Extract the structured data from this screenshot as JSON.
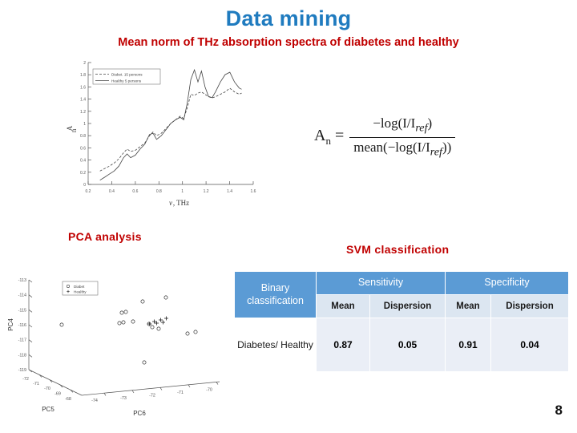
{
  "slide": {
    "title": "Data mining",
    "subtitle": "Mean norm of THz absorption spectra of diabetes and healthy",
    "page_number": "8",
    "title_color": "#1f7bbf",
    "accent_color": "#c00000"
  },
  "labels": {
    "pca": "PCA analysis",
    "svm": "SVM classification"
  },
  "formula": {
    "lhs": "A",
    "lhs_sub": "n",
    "equals": "=",
    "numerator": "−log(I/I",
    "numerator_sub": "ref",
    "numerator_tail": ")",
    "denominator_head": "mean(−log(I/I",
    "denominator_sub": "ref",
    "denominator_tail": "))"
  },
  "chart_data": [
    {
      "type": "line",
      "title": "Mean norm of THz absorption spectra of diabetes and healthy",
      "xlabel": "ν, THz",
      "ylabel": "Aₙ",
      "xlim": [
        0.2,
        1.6
      ],
      "ylim": [
        0,
        2
      ],
      "xticks": [
        "0.2",
        "0.4",
        "0.6",
        "0.8",
        "1",
        "1.2",
        "1.4",
        "1.6"
      ],
      "yticks": [
        "0",
        "0.2",
        "0.4",
        "0.6",
        "0.8",
        "1",
        "1.2",
        "1.4",
        "1.6",
        "1.8",
        "2"
      ],
      "grid": false,
      "legend_position": "upper-left",
      "series": [
        {
          "name": "Diabet. 15 persons",
          "style": "dashed",
          "x": [
            0.3,
            0.34,
            0.38,
            0.42,
            0.46,
            0.5,
            0.53,
            0.56,
            0.6,
            0.64,
            0.68,
            0.72,
            0.75,
            0.78,
            0.82,
            0.86,
            0.9,
            0.94,
            0.98,
            1.01,
            1.04,
            1.07,
            1.1,
            1.13,
            1.16,
            1.19,
            1.22,
            1.25,
            1.28,
            1.32,
            1.36,
            1.4,
            1.44,
            1.48,
            1.5
          ],
          "y": [
            0.22,
            0.26,
            0.3,
            0.35,
            0.42,
            0.52,
            0.58,
            0.54,
            0.56,
            0.62,
            0.68,
            0.8,
            0.86,
            0.8,
            0.84,
            0.92,
            1.0,
            1.06,
            1.12,
            1.08,
            1.26,
            1.48,
            1.46,
            1.5,
            1.52,
            1.48,
            1.44,
            1.42,
            1.44,
            1.48,
            1.52,
            1.58,
            1.52,
            1.48,
            1.5
          ]
        },
        {
          "name": "Healthy 5 persons",
          "style": "solid",
          "x": [
            0.3,
            0.34,
            0.38,
            0.42,
            0.46,
            0.5,
            0.53,
            0.56,
            0.6,
            0.64,
            0.68,
            0.72,
            0.75,
            0.78,
            0.82,
            0.86,
            0.9,
            0.94,
            0.98,
            1.01,
            1.04,
            1.07,
            1.1,
            1.13,
            1.16,
            1.19,
            1.22,
            1.25,
            1.28,
            1.32,
            1.36,
            1.4,
            1.44,
            1.48,
            1.5
          ],
          "y": [
            0.07,
            0.12,
            0.17,
            0.22,
            0.3,
            0.44,
            0.5,
            0.44,
            0.48,
            0.58,
            0.66,
            0.82,
            0.84,
            0.74,
            0.8,
            0.9,
            0.98,
            1.04,
            1.1,
            1.06,
            1.34,
            1.72,
            1.88,
            1.68,
            1.86,
            1.6,
            1.44,
            1.42,
            1.52,
            1.68,
            1.8,
            1.84,
            1.66,
            1.56,
            1.52
          ]
        }
      ]
    },
    {
      "type": "scatter",
      "title": "PCA analysis",
      "projection": "3d",
      "xlabel": "PC5",
      "ylabel": "PC6",
      "zlabel": "PC4",
      "zticks": [
        "-113",
        "-114",
        "-115",
        "-116",
        "-117",
        "-118",
        "-119"
      ],
      "xticks": [
        "-72",
        "-71",
        "-70",
        "-69",
        "-68"
      ],
      "yticks": [
        "-74",
        "-73",
        "-72",
        "-71",
        "-70"
      ],
      "grid": false,
      "legend_position": "upper-left",
      "series": [
        {
          "name": "Diabet",
          "marker": "circle",
          "points": [
            [
              0.22,
              0.42
            ],
            [
              0.52,
              0.28
            ],
            [
              0.62,
              0.22
            ],
            [
              0.78,
              0.16
            ],
            [
              0.5,
              0.38
            ],
            [
              0.56,
              0.36
            ],
            [
              0.68,
              0.4
            ],
            [
              0.72,
              0.44
            ],
            [
              0.88,
              0.5
            ],
            [
              0.93,
              0.5
            ],
            [
              0.64,
              0.78
            ],
            [
              0.7,
              0.42
            ],
            [
              0.66,
              0.46
            ]
          ]
        },
        {
          "name": "Healthy",
          "marker": "plus",
          "points": [
            [
              0.65,
              0.4
            ],
            [
              0.67,
              0.39
            ],
            [
              0.69,
              0.38
            ],
            [
              0.71,
              0.4
            ],
            [
              0.73,
              0.37
            ],
            [
              0.7,
              0.42
            ],
            [
              0.72,
              0.41
            ]
          ]
        }
      ]
    }
  ],
  "table": {
    "header": {
      "binary_classification": "Binary classification",
      "sensitivity": "Sensitivity",
      "specificity": "Specificity"
    },
    "subheader": {
      "sens_mean": "Mean",
      "sens_dispersion": "Dispersion",
      "spec_mean": "Mean",
      "spec_dispersion": "Dispersion"
    },
    "rows": [
      {
        "label": "Diabetes/ Healthy",
        "sens_mean": "0.87",
        "sens_dispersion": "0.05",
        "spec_mean": "0.91",
        "spec_dispersion": "0.04"
      }
    ],
    "colors": {
      "header_bg": "#5b9bd5",
      "subheader_bg": "#dce6f1",
      "value_bg": "#eaeef6"
    }
  }
}
